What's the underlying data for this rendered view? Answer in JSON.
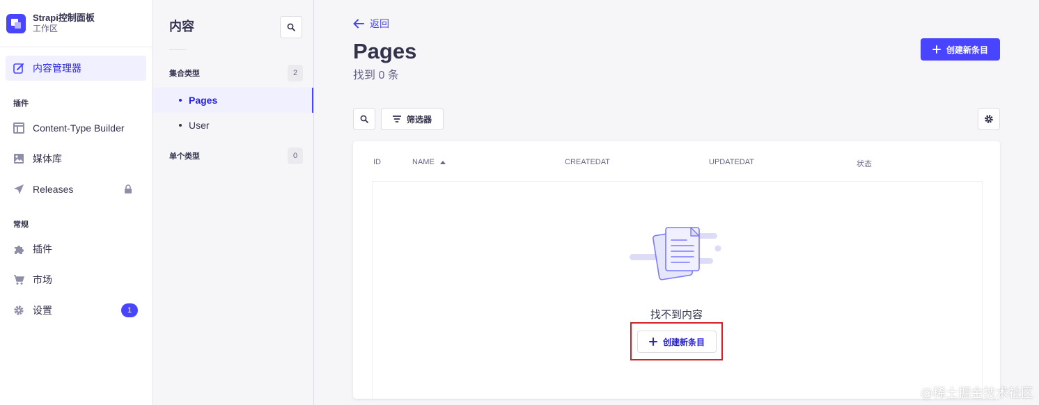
{
  "brand": {
    "title": "Strapi控制面板",
    "subtitle": "工作区"
  },
  "main_nav": {
    "content_manager": "内容管理器",
    "section_plugins": "插件",
    "content_type_builder": "Content-Type Builder",
    "media_library": "媒体库",
    "releases": "Releases",
    "section_general": "常规",
    "plugins": "插件",
    "marketplace": "市场",
    "settings": "设置",
    "settings_badge": "1"
  },
  "sub_nav": {
    "title": "内容",
    "collection_types": {
      "label": "集合类型",
      "count": "2"
    },
    "items": [
      "Pages",
      "User"
    ],
    "single_types": {
      "label": "单个类型",
      "count": "0"
    }
  },
  "content": {
    "back": "返回",
    "title": "Pages",
    "subtitle": "找到 0 条",
    "create_entry": "创建新条目",
    "filters": "筛选器",
    "columns": [
      "ID",
      "NAME",
      "CREATEDAT",
      "UPDATEDAT",
      "状态"
    ],
    "empty_text": "找不到内容",
    "empty_create": "创建新条目"
  },
  "watermark": "@稀土掘金技术社区",
  "colors": {
    "primary": "#4945ff",
    "primary_dark": "#271fe0",
    "highlight": "#d32027"
  }
}
